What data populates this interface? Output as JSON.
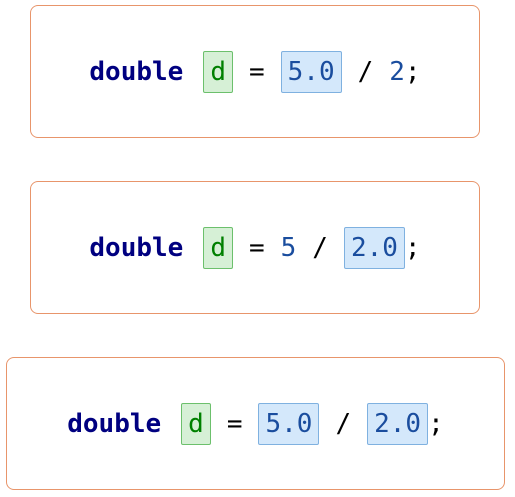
{
  "examples": [
    {
      "keyword": "double",
      "variable": "d",
      "assign": "=",
      "left_operand": "5.0",
      "divide": "/",
      "right_operand": "2",
      "terminator": ";"
    },
    {
      "keyword": "double",
      "variable": "d",
      "assign": "=",
      "left_operand": "5",
      "divide": "/",
      "right_operand": "2.0",
      "terminator": ";"
    },
    {
      "keyword": "double",
      "variable": "d",
      "assign": "=",
      "left_operand": "5.0",
      "divide": "/",
      "right_operand": "2.0",
      "terminator": ";"
    }
  ],
  "colors": {
    "panel_border": "#e8956b",
    "keyword": "#000080",
    "variable_text": "#008000",
    "variable_highlight": "#d6f0d6",
    "double_literal_highlight": "#d4e8fb",
    "number_text": "#1a4d9e"
  }
}
